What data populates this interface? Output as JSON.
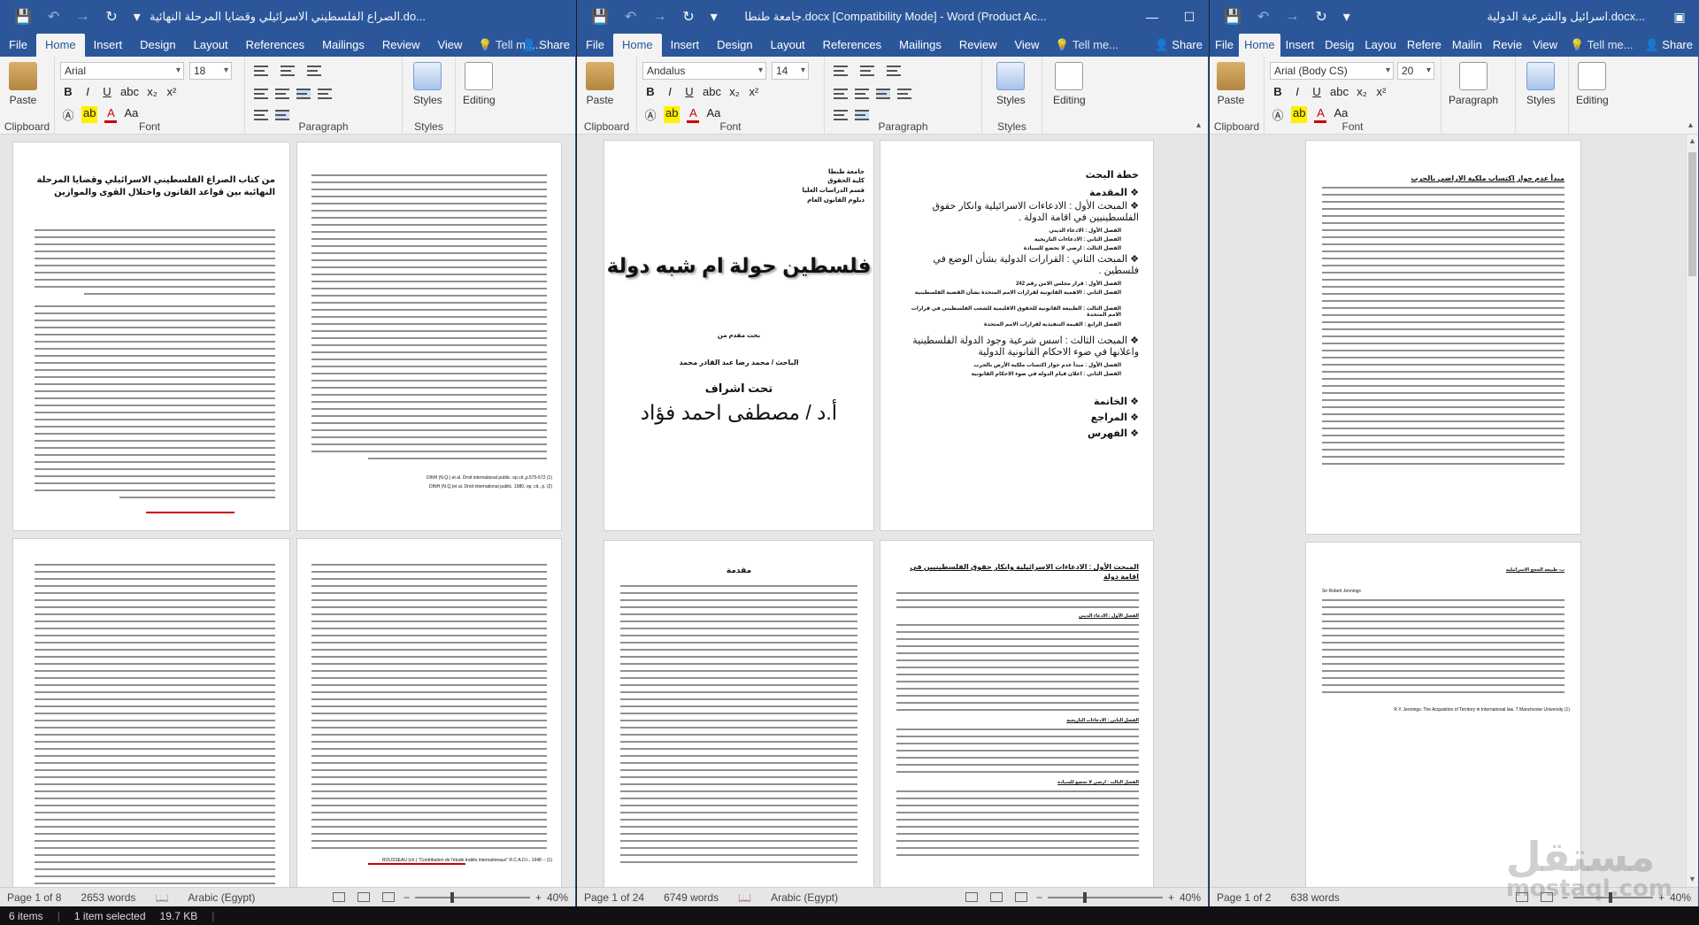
{
  "ribbon_tabs": [
    "File",
    "Home",
    "Insert",
    "Design",
    "Layout",
    "References",
    "Mailings",
    "Review",
    "View"
  ],
  "ribbon_tabs_narrow": [
    "File",
    "Home",
    "Insert",
    "Desig",
    "Layou",
    "Refere",
    "Mailin",
    "Revie",
    "View"
  ],
  "tell_me": "Tell me...",
  "share": "Share",
  "groups": {
    "clipboard": "Clipboard",
    "font": "Font",
    "paragraph": "Paragraph",
    "styles": "Styles"
  },
  "buttons": {
    "paste": "Paste",
    "styles": "Styles",
    "editing": "Editing",
    "paragraph": "Paragraph"
  },
  "format_glyphs": {
    "bold": "B",
    "italic": "I",
    "underline": "U",
    "strike": "abc",
    "sub": "x₂",
    "sup": "x²",
    "aa": "Aa",
    "grow": "A",
    "shrink": "A"
  },
  "win1": {
    "title": "الصراع الفلسطيني الاسرائيلي وقضايا المرحلة النهائية.do...",
    "font": "Arial",
    "size": "18",
    "status_page": "Page 1 of 8",
    "status_words": "2653 words",
    "status_lang": "Arabic (Egypt)",
    "zoom": "40%",
    "page1_title": "من كتاب الصراع الفلسطيني الاسرائيلي وقضايا المرحلة النهائية بين قواعد القانون واختلال القوى والموازين",
    "footnote1": "DINH (N.Q.) et al. Droit international public. op.cit.,p.575-572 (1)",
    "footnote2": "DINH (N.Q.)et al. Droit international public. 1980, op. cit., p. (2)",
    "footnote3": "ROUSSEAU (ch.) \"Contribution de l'étude traités internationaux\" R.C.A.D.I., 1948 -- (1)"
  },
  "win2": {
    "title": "جامعة طنطا.docx [Compatibility Mode] - Word (Product Ac...",
    "font": "Andalus",
    "size": "14",
    "status_page": "Page 1 of 24",
    "status_words": "6749 words",
    "status_lang": "Arabic (Egypt)",
    "zoom": "40%",
    "cover_header": [
      "جامعة طنطا",
      "كلية الحقوق",
      "قسم الدراسات العليا",
      "دبلوم القانون العام"
    ],
    "cover_title": "فلسطين حولة ام شبه دولة",
    "cover_by": "بحث مقدم من",
    "cover_student": "الباحث / محمد رضا عبد القادر محمد",
    "cover_supervision": "تحت اشراف",
    "cover_supervisor": "أ.د / مصطفى احمد فؤاد",
    "plan_title": "خطة البحث",
    "plan_intro": "المقدمة",
    "plan_ch1": "المبحث الأول : الادعاءات الاسرائيلية وانكار حقوق الفلسطينيين في اقامة الدولة .",
    "plan_ch1_items": [
      "الفصل الأول : الادعاء الديني",
      "الفصل الثاني : الادعاءات التاريخية",
      "الفصل الثالث : ارضي لا تخضع للسيادة"
    ],
    "plan_ch2": "المبحث الثاني : القرارات الدولية بشأن الوضع في فلسطين .",
    "plan_ch2_items": [
      "الفصل الأول : قرار مجلس الامن رقم 242",
      "الفصل الثاني : الاهمية القانونية لقرارات الامم المتحدة بشأن القضية الفلسطينية",
      "الفصل الثالث : الطبيعة القانونية للحقوق الاقليمية للشعب الفلسطيني في قرارات الامم المتحدة",
      "الفصل الرابع : القيمة التنفيذية لقرارات الامم المتحدة"
    ],
    "plan_ch3": "المبحث الثالث : اسس شرعية وجود الدولة الفلسطينية واعلانها في ضوء الاحكام القانونية الدولية",
    "plan_ch3_items": [
      "الفصل الأول : مبدأ عدم جواز اكتساب ملكية الأرض بالحرب",
      "الفصل الثاني : اعلان قيام الدولة في ضوء الاحكام القانونية"
    ],
    "plan_end": [
      "الخاتمة",
      "المراجع",
      "الفهرس"
    ],
    "p3_title": "مقدمة",
    "p4_title": "المبحث الأول : الادعاءات الاسرائيلية وانكار حقوق الفلسطينيين في اقامة دولة",
    "p4_sub": [
      "الفصل الأول : الادعاء الديني",
      "الفصل الثاني : الادعاءات التاريخية",
      "الفصل الثالث : ارضي لا تخضع للسيادة"
    ]
  },
  "win3": {
    "title": "اسرائيل والشرعية الدولية.docx...",
    "font": "Arial (Body CS)",
    "size": "20",
    "status_page": "Page 1 of 2",
    "status_words": "638 words",
    "zoom": "40%",
    "p1_title": "مبدأ عدم جواز اكتساب ملكية الاراضي بالحرب",
    "p2_heading": "ب- طبيعة الحجج الاسرائيلية",
    "p2_ref": "R.Y. Jennings: The Acquisition of Territory in International law. T Manchester University (1)",
    "p2_sir": "Sir Robert Jennings"
  },
  "explorer": {
    "items": "6 items",
    "selected": "1 item selected",
    "size": "19.7 KB"
  },
  "watermark": {
    "main": "مستقل",
    "sub": "mostaql.com"
  }
}
